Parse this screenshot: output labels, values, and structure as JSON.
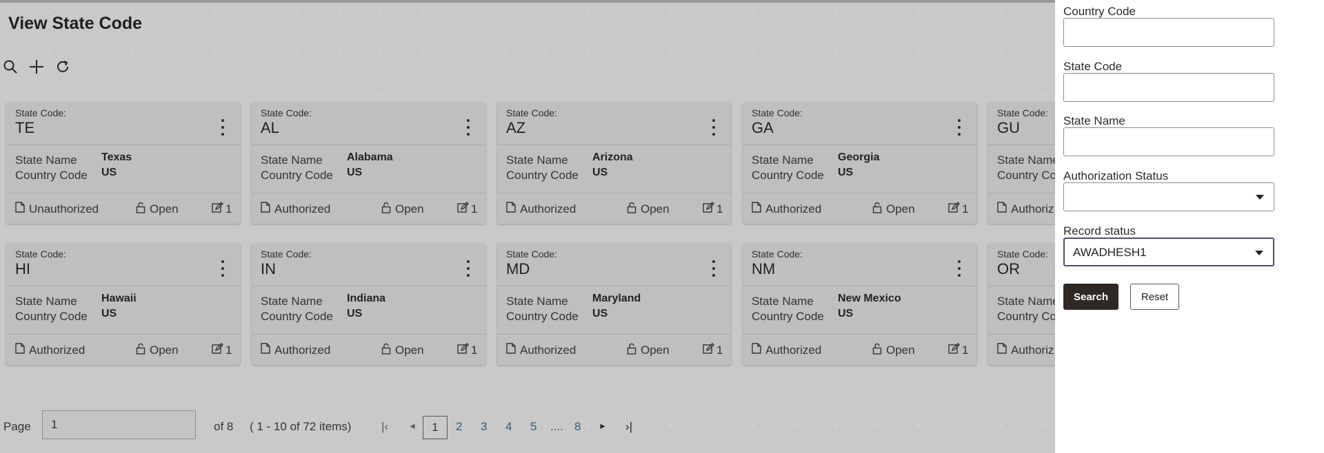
{
  "page": {
    "title": "View State Code"
  },
  "toolbar": {
    "icons": [
      "search-icon",
      "add-icon",
      "refresh-icon"
    ]
  },
  "card_labels": {
    "state_code": "State Code:",
    "state_name": "State Name",
    "country_code": "Country Code",
    "open": "Open"
  },
  "cards": [
    {
      "code": "TE",
      "name": "Texas",
      "country": "US",
      "auth": "Unauthorized",
      "mod": "1"
    },
    {
      "code": "AL",
      "name": "Alabama",
      "country": "US",
      "auth": "Authorized",
      "mod": "1"
    },
    {
      "code": "AZ",
      "name": "Arizona",
      "country": "US",
      "auth": "Authorized",
      "mod": "1"
    },
    {
      "code": "GA",
      "name": "Georgia",
      "country": "US",
      "auth": "Authorized",
      "mod": "1"
    },
    {
      "code": "GU",
      "name": "",
      "country": "",
      "auth": "Authoriz",
      "mod": ""
    },
    {
      "code": "HI",
      "name": "Hawaii",
      "country": "US",
      "auth": "Authorized",
      "mod": "1"
    },
    {
      "code": "IN",
      "name": "Indiana",
      "country": "US",
      "auth": "Authorized",
      "mod": "1"
    },
    {
      "code": "MD",
      "name": "Maryland",
      "country": "US",
      "auth": "Authorized",
      "mod": "1"
    },
    {
      "code": "NM",
      "name": "New Mexico",
      "country": "US",
      "auth": "Authorized",
      "mod": "1"
    },
    {
      "code": "OR",
      "name": "",
      "country": "",
      "auth": "Authoriz",
      "mod": ""
    }
  ],
  "pagination": {
    "page_label": "Page",
    "page_value": "1",
    "of_text": "of 8",
    "items_text": "( 1 - 10 of 72 items)",
    "pages": [
      "1",
      "2",
      "3",
      "4",
      "5",
      "....",
      "8"
    ],
    "current_page": "1"
  },
  "search_panel": {
    "country_code_label": "Country Code",
    "country_code_value": "",
    "state_code_label": "State Code",
    "state_code_value": "",
    "state_name_label": "State Name",
    "state_name_value": "",
    "auth_status_label": "Authorization Status",
    "auth_status_value": "",
    "record_status_label": "Record status",
    "record_status_value": "AWADHESH1",
    "search_button": "Search",
    "reset_button": "Reset"
  },
  "colors": {
    "overlay": "#c9c9c9",
    "search_button_bg": "#302824",
    "link": "#2a5f82"
  }
}
